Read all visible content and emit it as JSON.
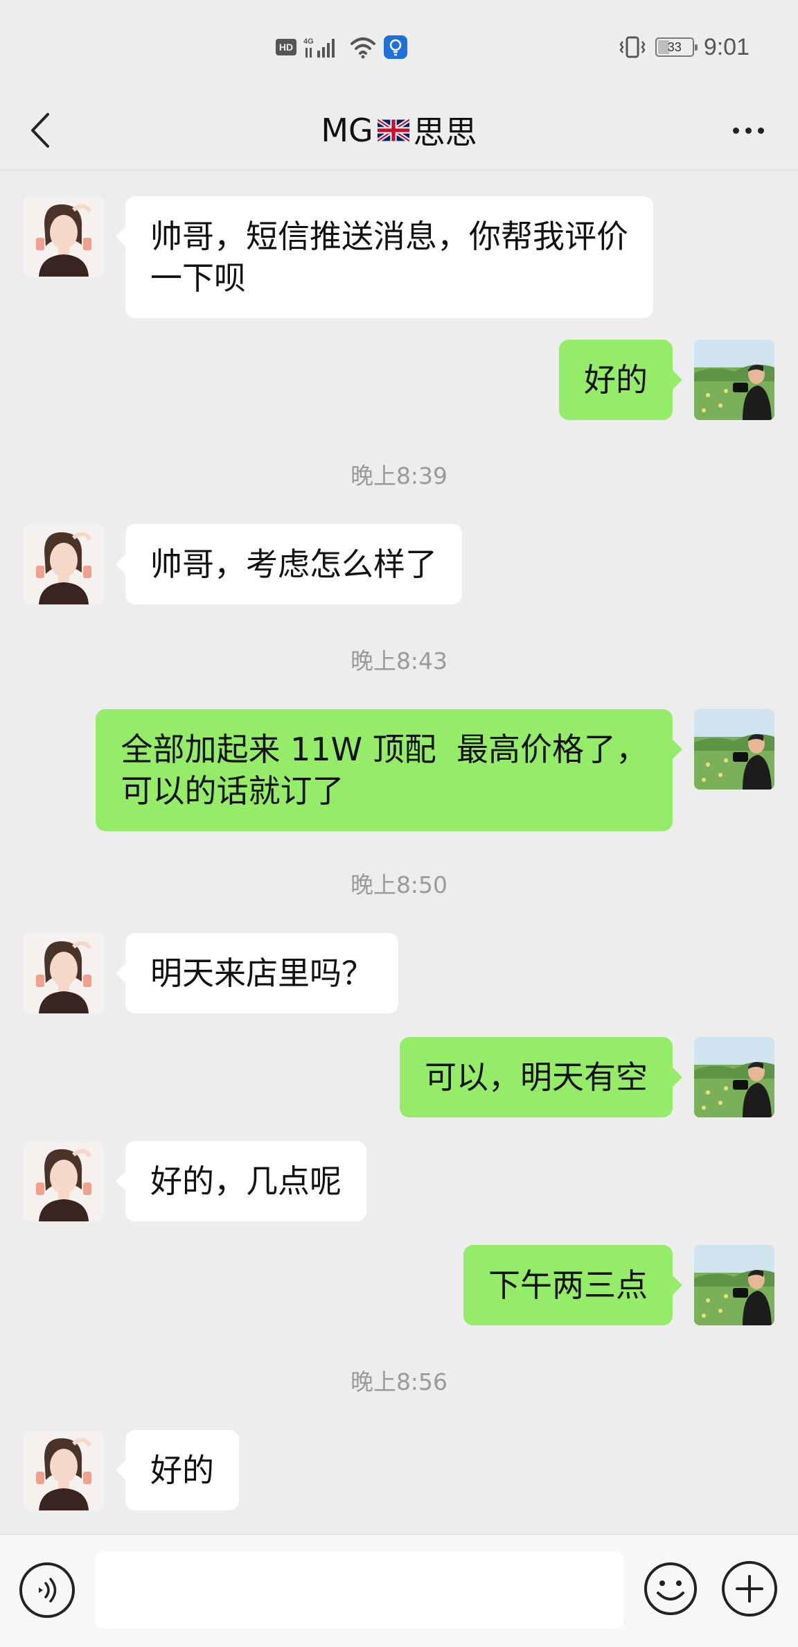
{
  "status_bar": {
    "hd_label": "HD",
    "network_label": "4G",
    "battery_level": "33",
    "battery_fraction": 0.33,
    "time": "9:01"
  },
  "nav": {
    "title_prefix": "MG",
    "title_suffix": "思思"
  },
  "colors": {
    "background": "#ededed",
    "incoming_bubble": "#ffffff",
    "outgoing_bubble": "#95ec69",
    "timestamp_text": "#9a9a9a"
  },
  "messages": {
    "m1": "帅哥，短信推送消息，你帮我评价\n一下呗",
    "m2": "好的",
    "t1": "晚上8:39",
    "m3": "帅哥，考虑怎么样了",
    "t2": "晚上8:43",
    "m4": "全部加起来 11W 顶配  最高价格了，\n可以的话就订了",
    "t3": "晚上8:50",
    "m5": "明天来店里吗？",
    "m6": "可以，明天有空",
    "m7": "好的，几点呢",
    "m8": "下午两三点",
    "t4": "晚上8:56",
    "m9": "好的"
  },
  "input": {
    "value": "",
    "voice_icon": "voice-icon",
    "emoji_icon": "emoji-icon",
    "plus_icon": "plus-icon"
  }
}
